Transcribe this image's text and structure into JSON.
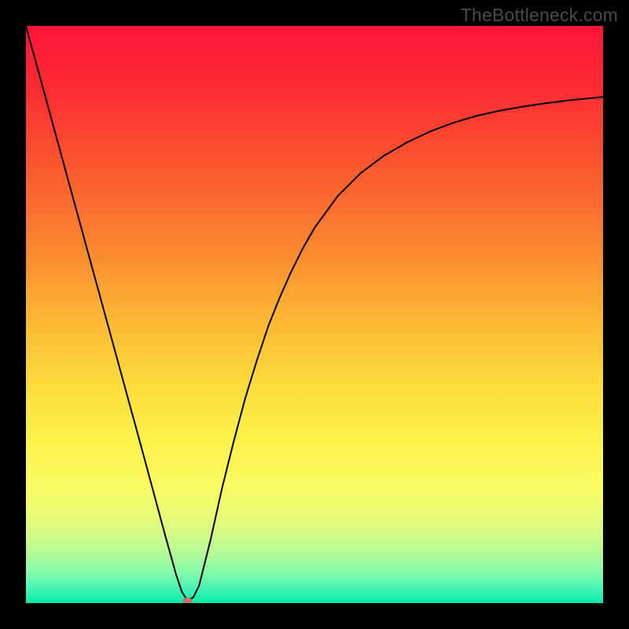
{
  "watermark": {
    "text": "TheBottleneck.com"
  },
  "chart_data": {
    "type": "line",
    "title": "",
    "xlabel": "",
    "ylabel": "",
    "xlim": [
      0,
      100
    ],
    "ylim": [
      0,
      100
    ],
    "grid": false,
    "legend": false,
    "background_gradient": {
      "direction": "vertical_top_to_bottom",
      "stops": [
        {
          "pos": 0.0,
          "color": "#fc1537"
        },
        {
          "pos": 0.12,
          "color": "#fb2f32"
        },
        {
          "pos": 0.25,
          "color": "#fb5a2f"
        },
        {
          "pos": 0.38,
          "color": "#fb8530"
        },
        {
          "pos": 0.5,
          "color": "#fcb432"
        },
        {
          "pos": 0.62,
          "color": "#fcdb3e"
        },
        {
          "pos": 0.72,
          "color": "#fcf24d"
        },
        {
          "pos": 0.8,
          "color": "#fbfc63"
        },
        {
          "pos": 0.86,
          "color": "#e4fc7b"
        },
        {
          "pos": 0.91,
          "color": "#b8fb94"
        },
        {
          "pos": 0.95,
          "color": "#7ff9ac"
        },
        {
          "pos": 0.985,
          "color": "#2df2b6"
        },
        {
          "pos": 1.0,
          "color": "#00eaa8"
        }
      ]
    },
    "series": [
      {
        "name": "bottleneck-curve",
        "color": "#000000",
        "stroke_width": 2,
        "x": [
          0,
          2,
          4,
          6,
          8,
          10,
          12,
          14,
          16,
          18,
          20,
          22,
          24,
          26,
          27,
          28,
          29,
          30,
          32,
          34,
          36,
          38,
          40,
          42,
          44,
          46,
          48,
          50,
          54,
          58,
          62,
          66,
          70,
          74,
          78,
          82,
          86,
          90,
          94,
          98,
          100
        ],
        "y": [
          100,
          92.7,
          85.4,
          78.1,
          70.8,
          63.5,
          56.2,
          48.9,
          41.6,
          34.3,
          27.0,
          19.6,
          12.2,
          5.0,
          2.0,
          0.4,
          1.0,
          3.0,
          11.0,
          20.0,
          28.0,
          35.5,
          42.0,
          48.0,
          53.0,
          57.5,
          61.5,
          65.0,
          70.5,
          74.5,
          77.5,
          79.8,
          81.7,
          83.2,
          84.4,
          85.3,
          86.0,
          86.6,
          87.1,
          87.5,
          87.7
        ]
      }
    ],
    "annotations": [
      {
        "name": "minimum-marker",
        "kind": "dot",
        "x": 28,
        "y": 0.4,
        "rx": 6,
        "ry": 4,
        "color": "#c97263"
      }
    ]
  }
}
